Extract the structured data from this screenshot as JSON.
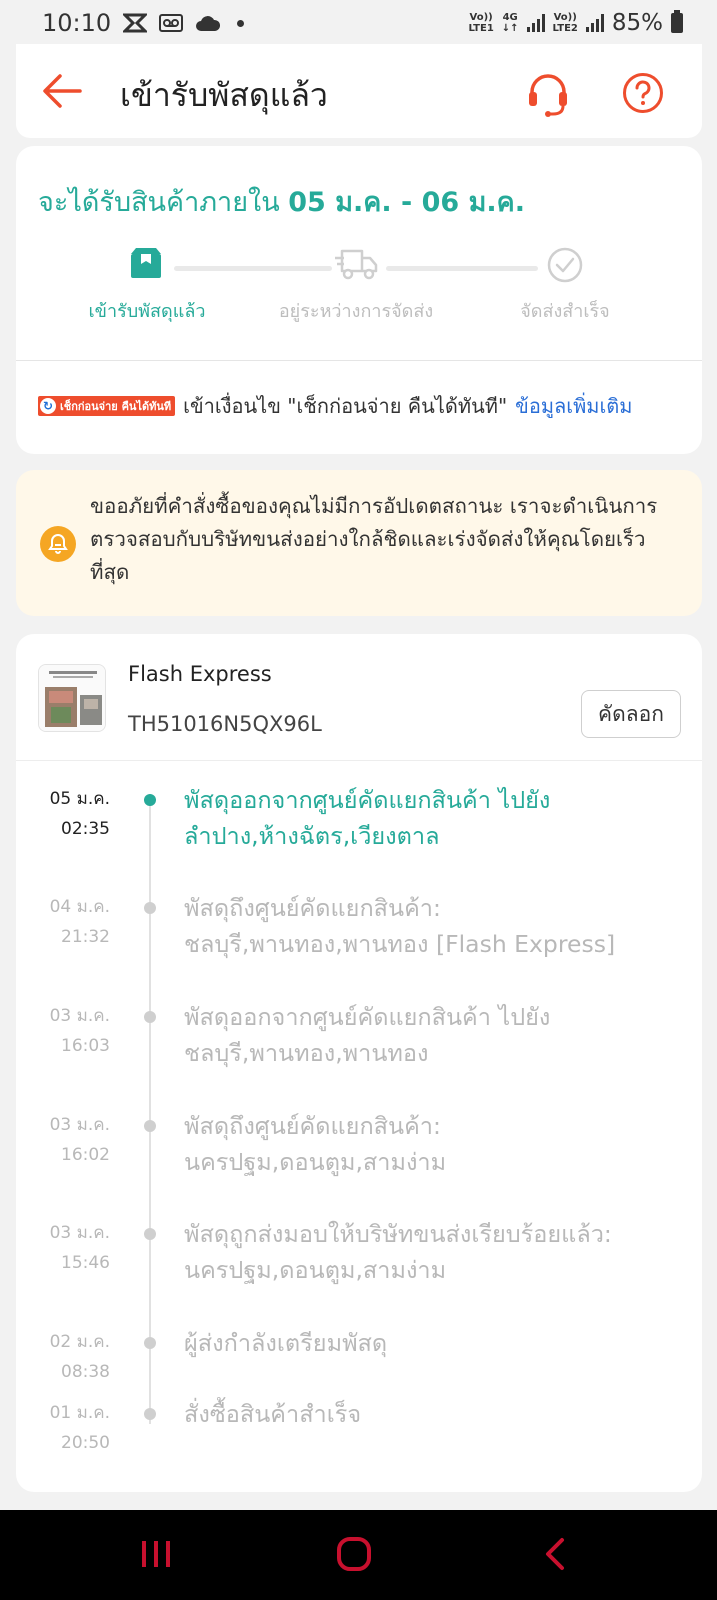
{
  "status_bar": {
    "time": "10:10",
    "battery": "85%",
    "sim1": "Vo)) LTE1",
    "net": "4G",
    "sim2": "Vo)) LTE2"
  },
  "header": {
    "title": "เข้ารับพัสดุแล้ว"
  },
  "delivery": {
    "eta_prefix": "จะได้รับสินค้าภายใน",
    "eta_range": "05 ม.ค. - 06 ม.ค.",
    "steps": [
      {
        "label": "เข้ารับพัสดุแล้ว",
        "active": true
      },
      {
        "label": "อยู่ระหว่างการจัดส่ง",
        "active": false
      },
      {
        "label": "จัดส่งสำเร็จ",
        "active": false
      }
    ],
    "promo_badge": "เช็กก่อนจ่าย คืนได้ทันที",
    "promo_text": "เข้าเงื่อนไข \"เช็กก่อนจ่าย คืนได้ทันที\"",
    "promo_link": "ข้อมูลเพิ่มเติม"
  },
  "notice": {
    "text": "ขออภัยที่คำสั่งซื้อของคุณไม่มีการอัปเดตสถานะ เราจะดำเนินการตรวจสอบกับบริษัทขนส่งอย่างใกล้ชิดและเร่งจัดส่งให้คุณโดยเร็วที่สุด"
  },
  "tracking": {
    "carrier": "Flash Express",
    "number": "TH51016N5QX96L",
    "copy_label": "คัดลอก",
    "events": [
      {
        "date": "05 ม.ค.",
        "time": "02:35",
        "text": "พัสดุออกจากศูนย์คัดแยกสินค้า ไปยัง ลำปาง,ห้างฉัตร,เวียงตาล",
        "current": true
      },
      {
        "date": "04 ม.ค.",
        "time": "21:32",
        "text": "พัสดุถึงศูนย์คัดแยกสินค้า: ชลบุรี,พานทอง,พานทอง  [Flash Express]",
        "current": false
      },
      {
        "date": "03 ม.ค.",
        "time": "16:03",
        "text": "พัสดุออกจากศูนย์คัดแยกสินค้า ไปยัง ชลบุรี,พานทอง,พานทอง",
        "current": false
      },
      {
        "date": "03 ม.ค.",
        "time": "16:02",
        "text": "พัสดุถึงศูนย์คัดแยกสินค้า: นครปฐม,ดอนตูม,สามง่าม",
        "current": false
      },
      {
        "date": "03 ม.ค.",
        "time": "15:46",
        "text": "พัสดุถูกส่งมอบให้บริษัทขนส่งเรียบร้อยแล้ว: นครปฐม,ดอนตูม,สามง่าม",
        "current": false
      },
      {
        "date": "02 ม.ค.",
        "time": "08:38",
        "text": "ผู้ส่งกำลังเตรียมพัสดุ",
        "current": false
      },
      {
        "date": "01 ม.ค.",
        "time": "20:50",
        "text": "สั่งซื้อสินค้าสำเร็จ",
        "current": false
      }
    ]
  },
  "colors": {
    "accent": "#ee4d2d",
    "teal": "#26aa99",
    "link": "#2a6ed6",
    "notice_bg": "#fff8e9"
  }
}
